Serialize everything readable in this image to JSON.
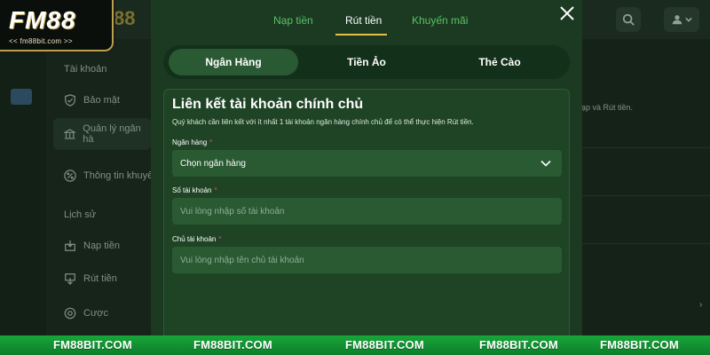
{
  "logo": {
    "text": "FM88",
    "subtitle": "<< fm88bit.com >>"
  },
  "background": {
    "logo_tail": "88",
    "sidebar": {
      "section_account": "Tài khoản",
      "item_security": "Bảo mật",
      "item_bank": "Quản lý ngân hà",
      "item_promo": "Thông tin khuyế",
      "section_history": "Lịch sử",
      "item_deposit": "Nạp tiền",
      "item_withdraw": "Rút tiền",
      "item_bet": "Cược"
    },
    "main_snippet": "nạp và Rút tiền."
  },
  "modal": {
    "tabs": [
      "Nạp tiền",
      "Rút tiền",
      "Khuyến mãi"
    ],
    "active_tab": "Rút tiền",
    "methods": [
      "Ngân Hàng",
      "Tiền Ảo",
      "Thẻ Cào"
    ],
    "active_method": "Ngân Hàng",
    "card": {
      "title": "Liên kết tài khoản chính chủ",
      "description": "Quý khách cần liên kết với ít nhất 1 tài khoản ngân hàng chính chủ để có thể thực hiện Rút tiền.",
      "bank_label": "Ngân hàng",
      "bank_value": "Chọn ngân hàng",
      "account_number_label": "Số tài khoản",
      "account_number_placeholder": "Vui lòng nhập số tài khoản",
      "account_holder_label": "Chủ tài khoản",
      "account_holder_placeholder": "Vui lòng nhập tên chủ tài khoản",
      "required_mark": "*"
    }
  },
  "footer": [
    "FM88BIT.COM",
    "FM88BIT.COM",
    "FM88BIT.COM",
    "FM88BIT.COM",
    "FM88BIT.COM"
  ],
  "icons": {
    "close": "close-icon",
    "chevron": "chevron-down-icon",
    "search": "search-icon",
    "user": "user-icon"
  },
  "colors": {
    "modal_bg": "#1b3a21",
    "card_bg": "#1e4425",
    "field_bg": "#2a5a32",
    "tab_green": "#59c16a",
    "tab_underline": "#e2c24b",
    "required": "#e05252",
    "footer_green": "#17a63a"
  }
}
